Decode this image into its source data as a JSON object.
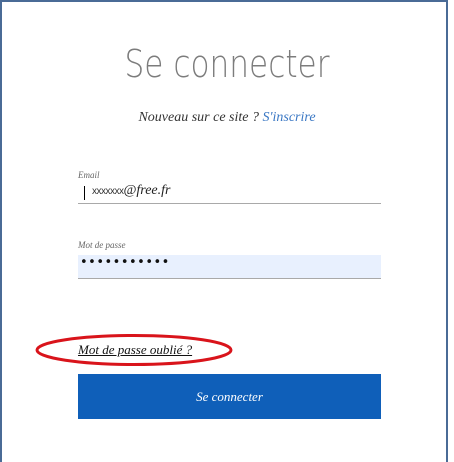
{
  "page": {
    "title": "Se connecter",
    "signup_prompt": "Nouveau sur ce site ?",
    "signup_link": "S'inscrire"
  },
  "form": {
    "email_label": "Email",
    "email_value_masked": "xxxxxxx",
    "email_value_domain": "@free.fr",
    "password_label": "Mot de passe",
    "password_value": "•••••••••••",
    "forgot_password_link": "Mot de passe oublié ?",
    "submit_label": "Se connecter"
  },
  "colors": {
    "frame_border": "#4a6b96",
    "link": "#3b78c4",
    "button_bg": "#0f5fb9",
    "password_autofill_bg": "#e8f0fe",
    "annotation_red": "#d9141b"
  }
}
